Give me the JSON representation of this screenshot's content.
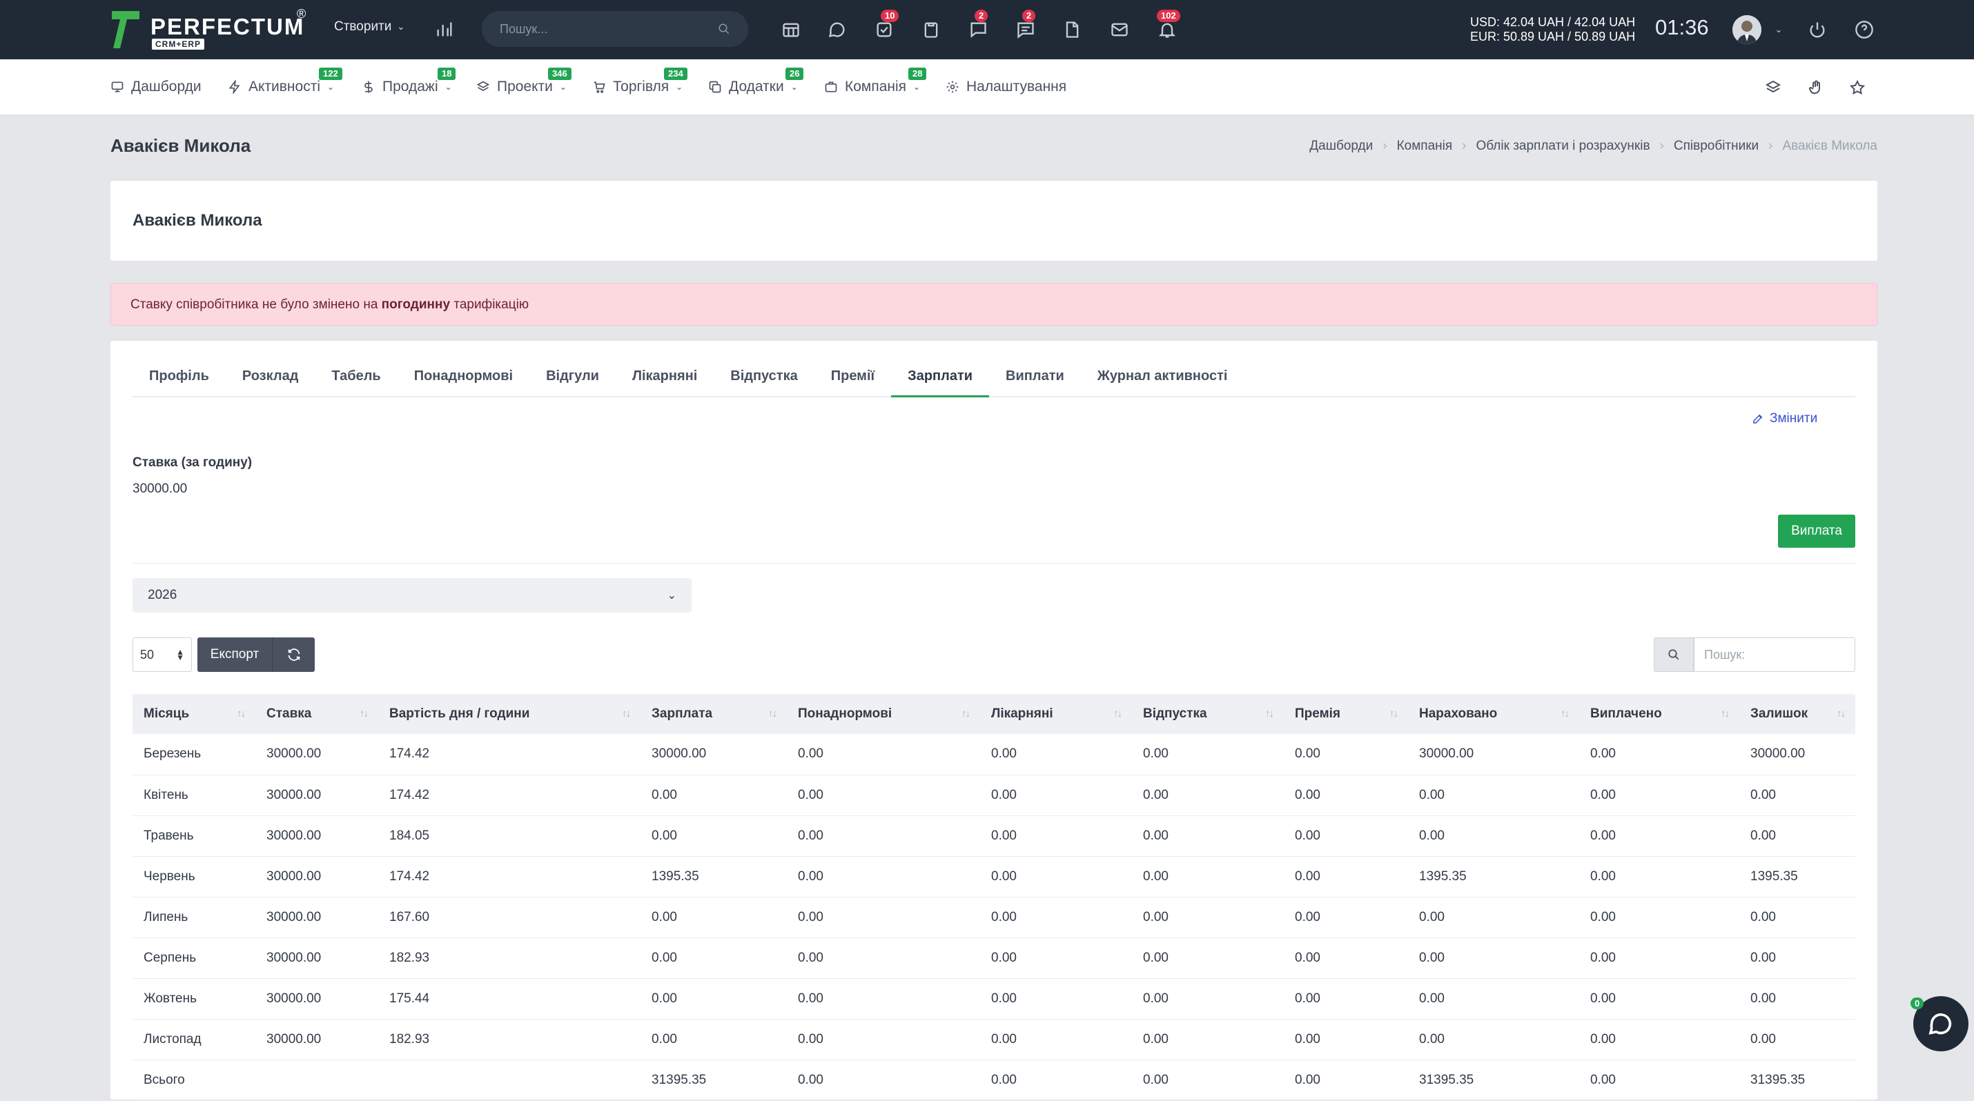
{
  "brand": {
    "name": "PERFECTUM",
    "reg": "®",
    "sub": "CRM+ERP"
  },
  "topbar": {
    "create_label": "Створити",
    "search_placeholder": "Пошук...",
    "badges": {
      "tasks": "10",
      "chat": "2",
      "discussions": "2",
      "notifications": "102"
    },
    "rates": {
      "usd": "USD: 42.04 UAH / 42.04 UAH",
      "eur": "EUR: 50.89 UAH / 50.89 UAH"
    },
    "time": "01:36"
  },
  "nav": [
    {
      "label": "Дашборди",
      "badge": ""
    },
    {
      "label": "Активності",
      "badge": "122"
    },
    {
      "label": "Продажі",
      "badge": "18"
    },
    {
      "label": "Проекти",
      "badge": "346"
    },
    {
      "label": "Торгівля",
      "badge": "234"
    },
    {
      "label": "Додатки",
      "badge": "26"
    },
    {
      "label": "Компанія",
      "badge": "28"
    },
    {
      "label": "Налаштування",
      "badge": ""
    }
  ],
  "page": {
    "title": "Авакієв Микола",
    "breadcrumb": [
      "Дашборди",
      "Компанія",
      "Облік зарплати і розрахунків",
      "Співробітники",
      "Авакієв Микола"
    ],
    "employee_name": "Авакієв Микола"
  },
  "alert": {
    "before": "Ставку співробітника не було змінено на ",
    "bold": "погодинну",
    "after": " тарифікацію"
  },
  "tabs": [
    "Профіль",
    "Розклад",
    "Табель",
    "Понаднормові",
    "Відгули",
    "Лікарняні",
    "Відпустка",
    "Премії",
    "Зарплати",
    "Виплати",
    "Журнал активності"
  ],
  "active_tab": "Зарплати",
  "salary": {
    "edit_label": "Змінити",
    "rate_label": "Ставка (за годину)",
    "rate_value": "30000.00",
    "pay_button": "Виплата",
    "year": "2026"
  },
  "table_controls": {
    "page_length": "50",
    "export_label": "Експорт",
    "search_placeholder": "Пошук:"
  },
  "table": {
    "columns": [
      "Місяць",
      "Ставка",
      "Вартість дня / години",
      "Зарплата",
      "Понаднормові",
      "Лікарняні",
      "Відпустка",
      "Премія",
      "Нараховано",
      "Виплачено",
      "Залишок"
    ],
    "rows": [
      [
        "Березень",
        "30000.00",
        "174.42",
        "30000.00",
        "0.00",
        "0.00",
        "0.00",
        "0.00",
        "30000.00",
        "0.00",
        "30000.00"
      ],
      [
        "Квітень",
        "30000.00",
        "174.42",
        "0.00",
        "0.00",
        "0.00",
        "0.00",
        "0.00",
        "0.00",
        "0.00",
        "0.00"
      ],
      [
        "Травень",
        "30000.00",
        "184.05",
        "0.00",
        "0.00",
        "0.00",
        "0.00",
        "0.00",
        "0.00",
        "0.00",
        "0.00"
      ],
      [
        "Червень",
        "30000.00",
        "174.42",
        "1395.35",
        "0.00",
        "0.00",
        "0.00",
        "0.00",
        "1395.35",
        "0.00",
        "1395.35"
      ],
      [
        "Липень",
        "30000.00",
        "167.60",
        "0.00",
        "0.00",
        "0.00",
        "0.00",
        "0.00",
        "0.00",
        "0.00",
        "0.00"
      ],
      [
        "Серпень",
        "30000.00",
        "182.93",
        "0.00",
        "0.00",
        "0.00",
        "0.00",
        "0.00",
        "0.00",
        "0.00",
        "0.00"
      ],
      [
        "Жовтень",
        "30000.00",
        "175.44",
        "0.00",
        "0.00",
        "0.00",
        "0.00",
        "0.00",
        "0.00",
        "0.00",
        "0.00"
      ],
      [
        "Листопад",
        "30000.00",
        "182.93",
        "0.00",
        "0.00",
        "0.00",
        "0.00",
        "0.00",
        "0.00",
        "0.00",
        "0.00"
      ],
      [
        "Всього",
        "",
        "",
        "31395.35",
        "0.00",
        "0.00",
        "0.00",
        "0.00",
        "31395.35",
        "0.00",
        "31395.35"
      ]
    ]
  },
  "chat": {
    "badge": "0"
  },
  "colors": {
    "topbar": "#202a36",
    "accent_green": "#23a455",
    "badge_red": "#e0334d",
    "alert_bg": "#fbd9df",
    "link_blue": "#3b4fcf"
  }
}
